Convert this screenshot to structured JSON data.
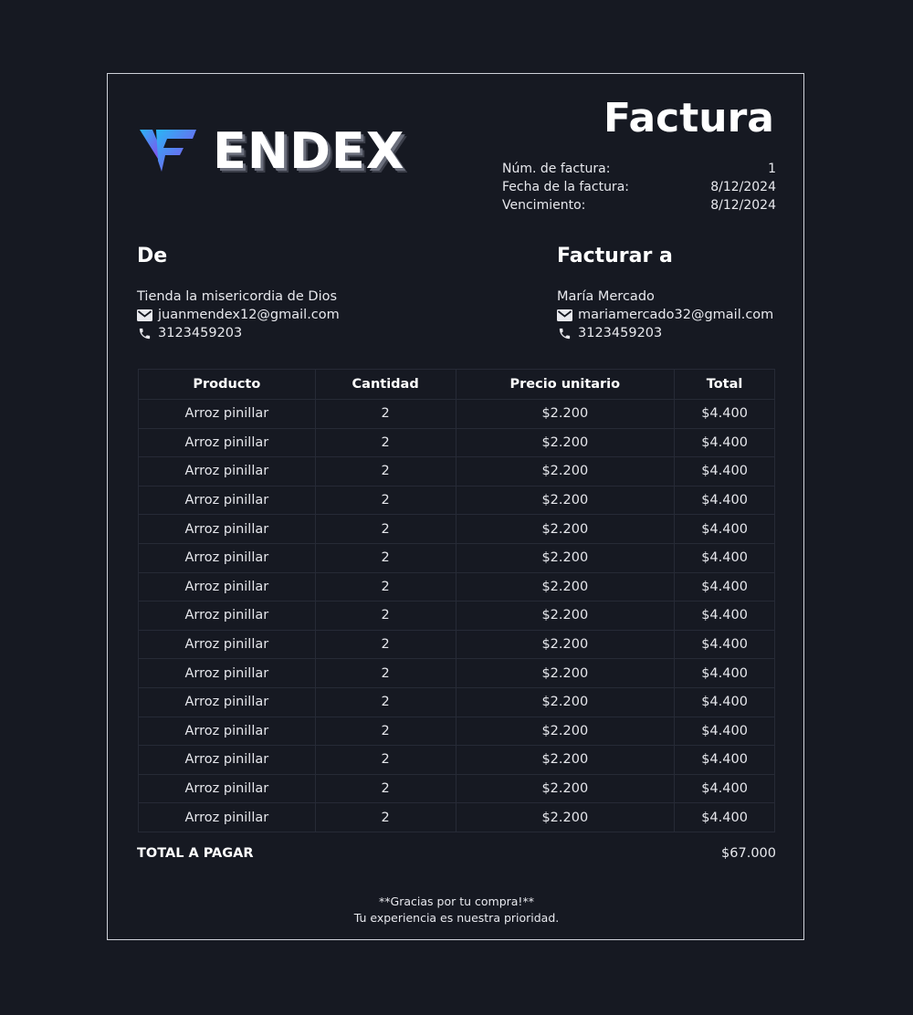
{
  "logo": {
    "text": "ENDEX"
  },
  "invoice": {
    "title": "Factura",
    "meta": [
      {
        "label": "Núm. de factura:",
        "value": "1"
      },
      {
        "label": "Fecha de la factura:",
        "value": "8/12/2024"
      },
      {
        "label": "Vencimiento:",
        "value": "8/12/2024"
      }
    ]
  },
  "from": {
    "heading": "De",
    "name": "Tienda la misericordia de Dios",
    "email": "juanmendex12@gmail.com",
    "phone": "3123459203"
  },
  "to": {
    "heading": "Facturar a",
    "name": "María Mercado",
    "email": "mariamercado32@gmail.com",
    "phone": "3123459203"
  },
  "table": {
    "headers": [
      "Producto",
      "Cantidad",
      "Precio unitario",
      "Total"
    ],
    "rows": [
      [
        "Arroz pinillar",
        "2",
        "$2.200",
        "$4.400"
      ],
      [
        "Arroz pinillar",
        "2",
        "$2.200",
        "$4.400"
      ],
      [
        "Arroz pinillar",
        "2",
        "$2.200",
        "$4.400"
      ],
      [
        "Arroz pinillar",
        "2",
        "$2.200",
        "$4.400"
      ],
      [
        "Arroz pinillar",
        "2",
        "$2.200",
        "$4.400"
      ],
      [
        "Arroz pinillar",
        "2",
        "$2.200",
        "$4.400"
      ],
      [
        "Arroz pinillar",
        "2",
        "$2.200",
        "$4.400"
      ],
      [
        "Arroz pinillar",
        "2",
        "$2.200",
        "$4.400"
      ],
      [
        "Arroz pinillar",
        "2",
        "$2.200",
        "$4.400"
      ],
      [
        "Arroz pinillar",
        "2",
        "$2.200",
        "$4.400"
      ],
      [
        "Arroz pinillar",
        "2",
        "$2.200",
        "$4.400"
      ],
      [
        "Arroz pinillar",
        "2",
        "$2.200",
        "$4.400"
      ],
      [
        "Arroz pinillar",
        "2",
        "$2.200",
        "$4.400"
      ],
      [
        "Arroz pinillar",
        "2",
        "$2.200",
        "$4.400"
      ],
      [
        "Arroz pinillar",
        "2",
        "$2.200",
        "$4.400"
      ]
    ]
  },
  "total": {
    "label": "TOTAL A PAGAR",
    "value": "$67.000"
  },
  "footer": {
    "line1": "**Gracias por tu compra!**",
    "line2": "Tu experiencia es nuestra prioridad."
  },
  "icons": {
    "email": "mail-icon",
    "phone": "phone-icon"
  },
  "colors": {
    "background": "#161922",
    "border": "#cfd2da",
    "logo_gradient_start": "#29b6f6",
    "logo_gradient_end": "#8e44ec"
  }
}
